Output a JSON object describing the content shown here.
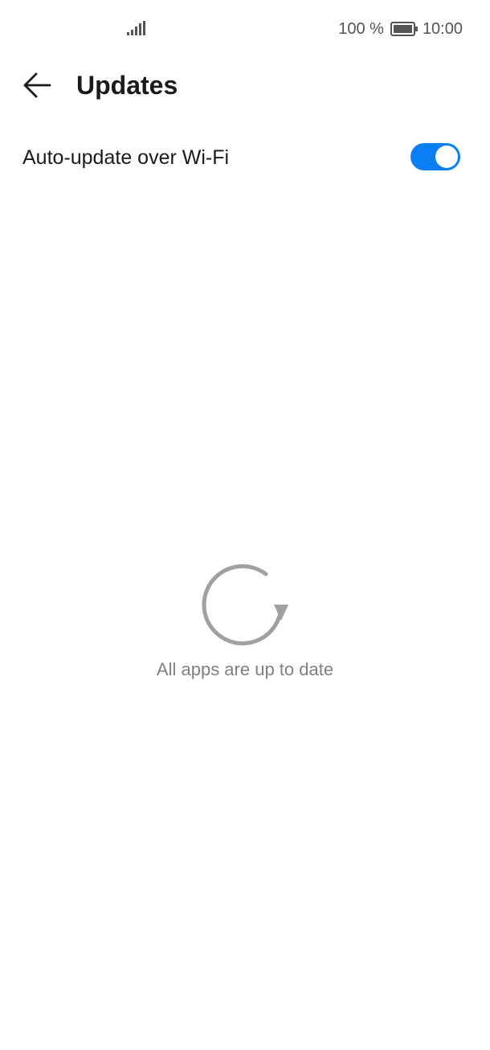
{
  "status_bar": {
    "battery_percent": "100 %",
    "time": "10:00",
    "signal_icon": "signal-bars-icon",
    "battery_icon": "battery-full-icon"
  },
  "header": {
    "title": "Updates",
    "back_icon": "arrow-left-icon"
  },
  "settings": {
    "auto_update_label": "Auto-update over Wi-Fi",
    "auto_update_enabled": true,
    "toggle_color": "#0a7ff5"
  },
  "empty_state": {
    "icon": "refresh-icon",
    "message": "All apps are up to date"
  }
}
